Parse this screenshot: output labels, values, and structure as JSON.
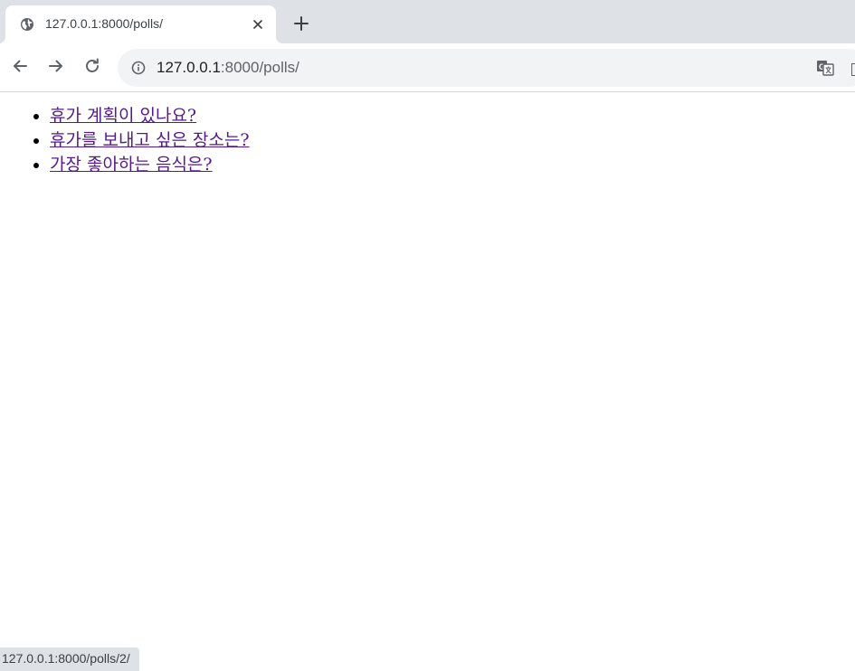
{
  "browser": {
    "tab": {
      "title": "127.0.0.1:8000/polls/",
      "favicon": "globe-icon"
    },
    "address_bar": {
      "host": "127.0.0.1",
      "rest": ":8000/polls/"
    },
    "icons": {
      "back": "arrow-left-icon",
      "forward": "arrow-right-icon",
      "reload": "reload-icon",
      "info": "info-icon",
      "translate": "translate-icon",
      "close_tab": "close-icon",
      "new_tab": "plus-icon"
    },
    "colors": {
      "tabstrip": "#dee1e6",
      "omnibox": "#f1f3f4",
      "link_visited": "#551a8b"
    }
  },
  "page": {
    "polls": [
      {
        "question": "휴가 계획이 있나요?"
      },
      {
        "question": "휴가를 보내고 싶은 장소는?"
      },
      {
        "question": "가장 좋아하는 음식은?"
      }
    ]
  },
  "status_bar": {
    "text": "127.0.0.1:8000/polls/2/"
  }
}
